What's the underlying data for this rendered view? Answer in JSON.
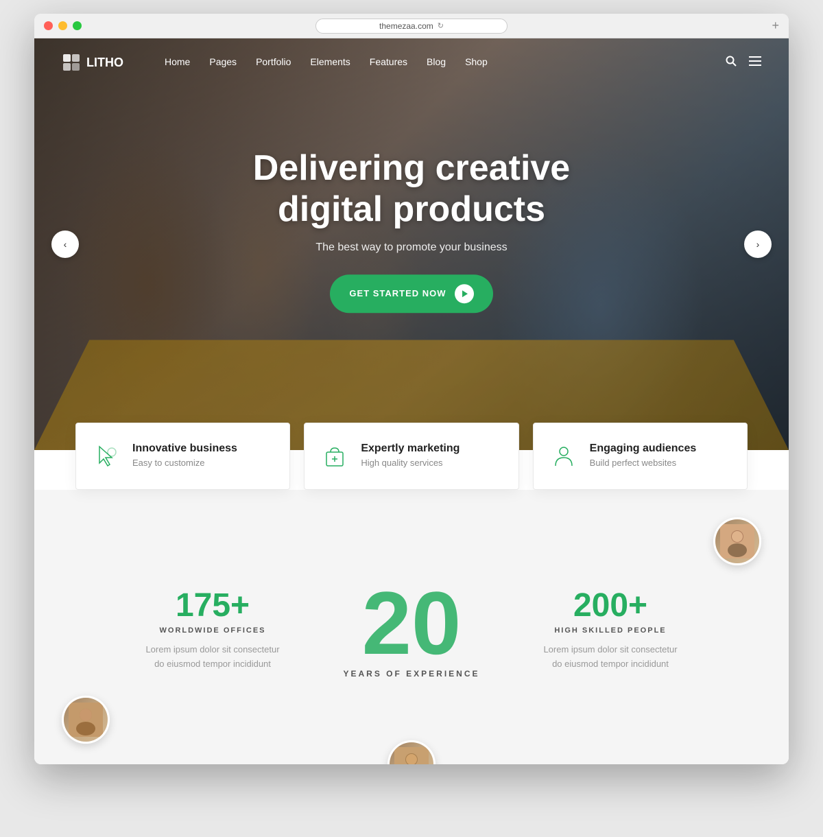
{
  "window": {
    "url": "themezaa.com",
    "plus_label": "+"
  },
  "nav": {
    "logo_text": "LITHO",
    "links": [
      "Home",
      "Pages",
      "Portfolio",
      "Elements",
      "Features",
      "Blog",
      "Shop"
    ]
  },
  "hero": {
    "title": "Delivering creative digital products",
    "subtitle": "The best way to promote your business",
    "cta_label": "GET STARTED NOW",
    "arrow_left": "‹",
    "arrow_right": "›"
  },
  "features": [
    {
      "id": "innovative",
      "title": "Innovative business",
      "description": "Easy to customize",
      "icon": "cursor"
    },
    {
      "id": "marketing",
      "title": "Expertly marketing",
      "description": "High quality services",
      "icon": "bag"
    },
    {
      "id": "audiences",
      "title": "Engaging audiences",
      "description": "Build perfect websites",
      "icon": "person"
    }
  ],
  "stats": [
    {
      "id": "offices",
      "number": "175+",
      "label": "WORLDWIDE OFFICES",
      "description": "Lorem ipsum dolor sit consectetur\ndo eiusmod tempor incididunt"
    },
    {
      "id": "experience",
      "number": "20",
      "label": "YEARS OF EXPERIENCE",
      "description": ""
    },
    {
      "id": "people",
      "number": "200+",
      "label": "HIGH SKILLED PEOPLE",
      "description": "Lorem ipsum dolor sit consectetur\ndo eiusmod tempor incididunt"
    }
  ]
}
